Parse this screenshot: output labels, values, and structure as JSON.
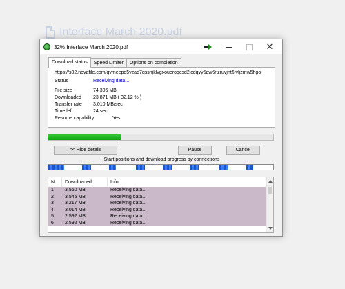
{
  "background_file": {
    "name": "Interface March 2020.pdf",
    "icon": "document-icon"
  },
  "window": {
    "title": "32% Interface March 2020.pdf",
    "icons": {
      "app": "idm-globe-icon",
      "arrow": "green-arrow-icon"
    },
    "controls": {
      "minimize": "minimize",
      "maximize": "maximize",
      "close": "✕"
    }
  },
  "tabs": [
    "Download status",
    "Speed Limiter",
    "Options on completion"
  ],
  "status": {
    "url": "https://s02.novafile.com/qvmeepd5vzad7qssnjklvgxoueroqcsd2lcdqyy5aw6rlzruvjnt5fvljzmw5hgo",
    "rows": [
      {
        "label": "Status",
        "value": "Receiving data..."
      },
      {
        "label": "File size",
        "value": "74.306  MB"
      },
      {
        "label": "Downloaded",
        "value": "23.871  MB  ( 32.12 % )"
      },
      {
        "label": "Transfer rate",
        "value": "3.010  MB/sec"
      },
      {
        "label": "Time left",
        "value": "24 sec"
      },
      {
        "label": "Resume capability",
        "value": "Yes"
      }
    ]
  },
  "progress_fraction": 0.3212,
  "buttons": {
    "hide_details": "<< Hide details",
    "pause": "Pause",
    "cancel": "Cancel"
  },
  "connections_label": "Start positions and download progress by connections",
  "connection_segments": [
    {
      "start": 0.0,
      "end": 0.07
    },
    {
      "start": 0.15,
      "end": 0.19
    },
    {
      "start": 0.27,
      "end": 0.3
    },
    {
      "start": 0.39,
      "end": 0.43
    },
    {
      "start": 0.51,
      "end": 0.55
    },
    {
      "start": 0.63,
      "end": 0.67
    },
    {
      "start": 0.76,
      "end": 0.8
    },
    {
      "start": 0.88,
      "end": 0.91
    }
  ],
  "table": {
    "headers": [
      "N.",
      "Downloaded",
      "Info"
    ],
    "rows": [
      [
        "1",
        "3.560  MB",
        "Receiving data..."
      ],
      [
        "2",
        "3.545  MB",
        "Receiving data..."
      ],
      [
        "3",
        "3.217  MB",
        "Receiving data..."
      ],
      [
        "4",
        "3.014  MB",
        "Receiving data..."
      ],
      [
        "5",
        "2.592  MB",
        "Receiving data..."
      ],
      [
        "6",
        "2.592  MB",
        "Receiving data..."
      ]
    ],
    "row_color": "#c9b9c9"
  },
  "colors": {
    "progress_green": "#1fb31f",
    "connection_blue": "#2a6ae0",
    "status_blue": "#0000c8"
  }
}
